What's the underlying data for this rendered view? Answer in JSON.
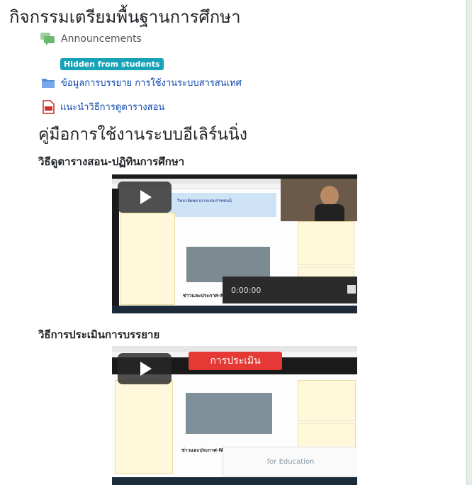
{
  "section": {
    "title": "กิจกรรมเตรียมพื้นฐานการศึกษา"
  },
  "activities": {
    "announcements": "Announcements",
    "hidden_badge": "Hidden from students",
    "folder": "ข้อมูลการบรรยาย การใช้งานระบบสารสนเทศ",
    "pdf": "แนะนำวิธีการดูตารางสอน"
  },
  "manual": {
    "heading": "คู่มือการใช้งานระบบอีเลิร์นนิ่ง",
    "video1_title": "วิธีดูตารางสอน-ปฏิทินการศึกษา",
    "video2_title": "วิธีการประเมินการบรรยาย"
  },
  "video1": {
    "page_heading": "วิทยาลัยพยาบาลบรมราชชนนี",
    "news_heading": "ข่าวและประกาศ-NEWS",
    "timer": "0:00:00"
  },
  "video2": {
    "banner": "การประเมิน",
    "news_heading": "ข่าวและประกาศ-NE",
    "overlay_text": "for Education"
  },
  "colors": {
    "accent": "#0f47ad",
    "badge": "#17a2b8",
    "banner": "#e53935"
  }
}
